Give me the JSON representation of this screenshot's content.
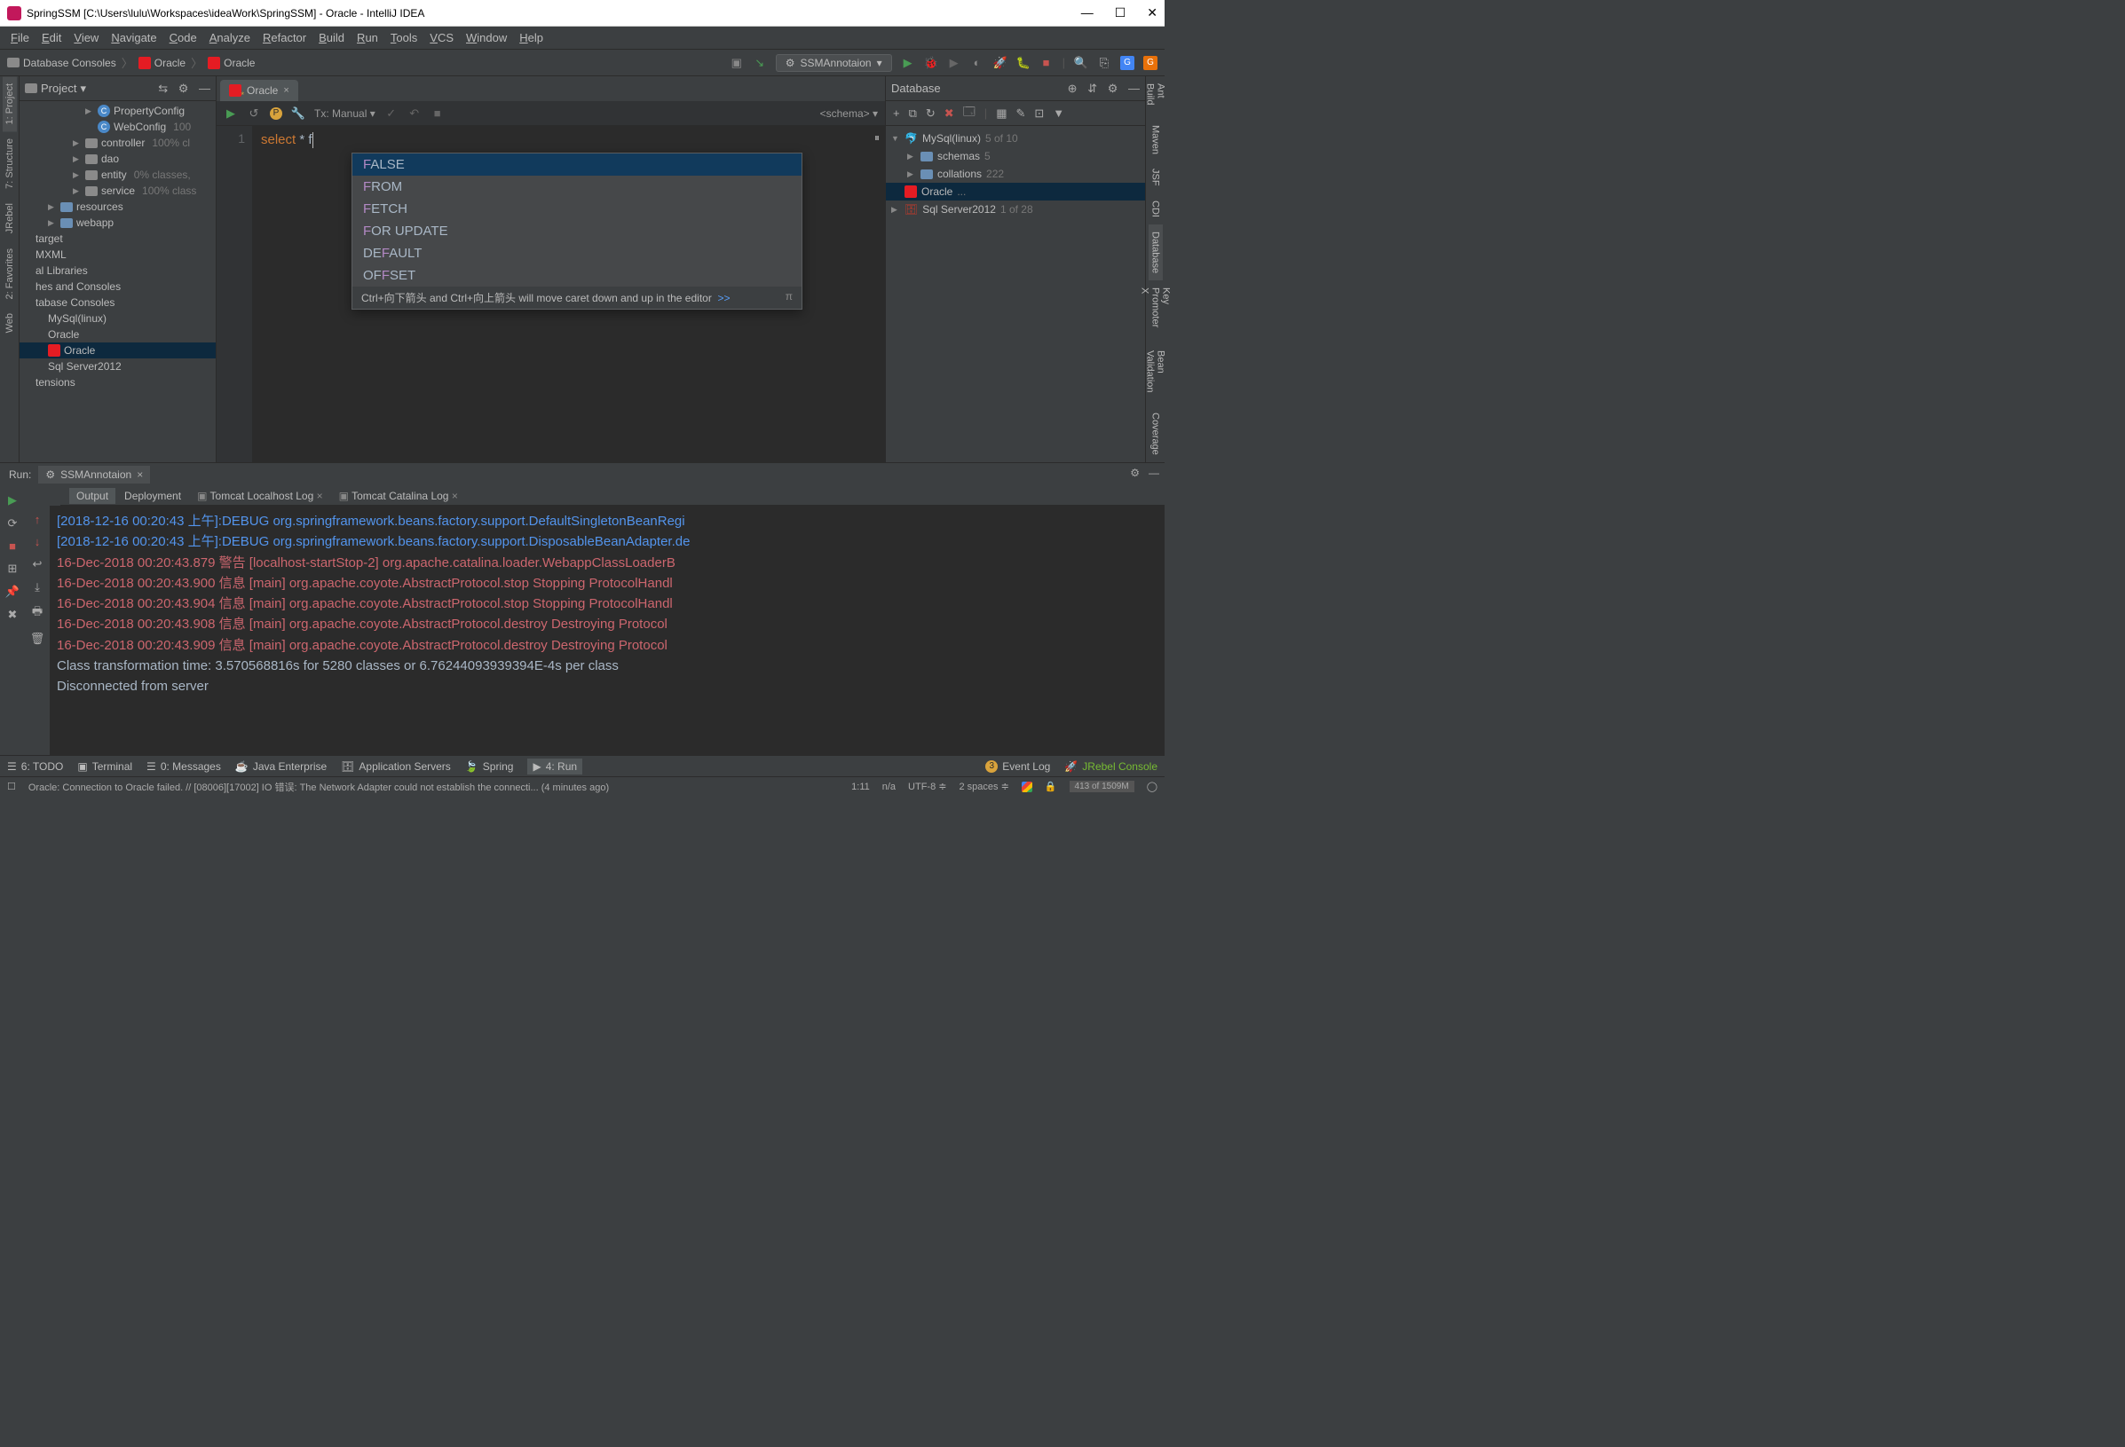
{
  "window": {
    "title": "SpringSSM [C:\\Users\\lulu\\Workspaces\\ideaWork\\SpringSSM] - Oracle - IntelliJ IDEA"
  },
  "menu": [
    "File",
    "Edit",
    "View",
    "Navigate",
    "Code",
    "Analyze",
    "Refactor",
    "Build",
    "Run",
    "Tools",
    "VCS",
    "Window",
    "Help"
  ],
  "breadcrumb": [
    "Database Consoles",
    "Oracle",
    "Oracle"
  ],
  "runConfig": "SSMAnnotaion",
  "projectPanel": {
    "title": "Project",
    "tree": [
      {
        "indent": 5,
        "arrow": "▶",
        "icon": "class",
        "label": "PropertyConfig",
        "hint": ""
      },
      {
        "indent": 5,
        "arrow": "",
        "icon": "class",
        "label": "WebConfig",
        "hint": "100"
      },
      {
        "indent": 4,
        "arrow": "▶",
        "icon": "folder",
        "label": "controller",
        "hint": "100% cl"
      },
      {
        "indent": 4,
        "arrow": "▶",
        "icon": "folder",
        "label": "dao",
        "hint": ""
      },
      {
        "indent": 4,
        "arrow": "▶",
        "icon": "folder",
        "label": "entity",
        "hint": "0% classes,"
      },
      {
        "indent": 4,
        "arrow": "▶",
        "icon": "folder",
        "label": "service",
        "hint": "100% class"
      },
      {
        "indent": 2,
        "arrow": "▶",
        "icon": "bfolder",
        "label": "resources",
        "hint": ""
      },
      {
        "indent": 2,
        "arrow": "▶",
        "icon": "bfolder",
        "label": "webapp",
        "hint": ""
      },
      {
        "indent": 0,
        "arrow": "",
        "icon": "",
        "label": "target",
        "hint": ""
      },
      {
        "indent": 0,
        "arrow": "",
        "icon": "",
        "label": "MXML",
        "hint": ""
      },
      {
        "indent": 0,
        "arrow": "",
        "icon": "",
        "label": "al Libraries",
        "hint": ""
      },
      {
        "indent": 0,
        "arrow": "",
        "icon": "",
        "label": "hes and Consoles",
        "hint": ""
      },
      {
        "indent": 0,
        "arrow": "",
        "icon": "",
        "label": "tabase Consoles",
        "hint": ""
      },
      {
        "indent": 1,
        "arrow": "",
        "icon": "",
        "label": "MySql(linux)",
        "hint": ""
      },
      {
        "indent": 1,
        "arrow": "",
        "icon": "",
        "label": "Oracle",
        "hint": ""
      },
      {
        "indent": 1,
        "arrow": "",
        "icon": "oracle",
        "label": "Oracle",
        "hint": "",
        "sel": true
      },
      {
        "indent": 1,
        "arrow": "",
        "icon": "",
        "label": "Sql Server2012",
        "hint": ""
      },
      {
        "indent": 0,
        "arrow": "",
        "icon": "",
        "label": "tensions",
        "hint": ""
      }
    ]
  },
  "editor": {
    "tabLabel": "Oracle",
    "txLabel": "Tx: Manual",
    "schemaLabel": "<schema>",
    "lineNo": "1",
    "code": {
      "kw": "select",
      "rest": " * f"
    },
    "completion": {
      "items": [
        {
          "pre": "",
          "hl": "F",
          "post": "ALSE",
          "sel": true
        },
        {
          "pre": "",
          "hl": "F",
          "post": "ROM"
        },
        {
          "pre": "",
          "hl": "F",
          "post": "ETCH"
        },
        {
          "pre": "",
          "hl": "F",
          "post": "OR UPDATE"
        },
        {
          "pre": "DE",
          "hl": "F",
          "post": "AULT"
        },
        {
          "pre": "OF",
          "hl": "F",
          "post": "SET"
        }
      ],
      "hint": "Ctrl+向下箭头 and Ctrl+向上箭头 will move caret down and up in the editor",
      "hintLink": ">>"
    }
  },
  "database": {
    "title": "Database",
    "tree": [
      {
        "indent": 0,
        "arrow": "▼",
        "icon": "mysql",
        "label": "MySql(linux)",
        "hint": "5 of 10"
      },
      {
        "indent": 1,
        "arrow": "▶",
        "icon": "bfolder",
        "label": "schemas",
        "hint": "5"
      },
      {
        "indent": 1,
        "arrow": "▶",
        "icon": "bfolder",
        "label": "collations",
        "hint": "222"
      },
      {
        "indent": 0,
        "arrow": "",
        "icon": "oracle",
        "label": "Oracle",
        "hint": "...",
        "sel": true
      },
      {
        "indent": 0,
        "arrow": "▶",
        "icon": "sqls",
        "label": "Sql Server2012",
        "hint": "1 of 28"
      }
    ]
  },
  "run": {
    "label": "Run:",
    "configTab": "SSMAnnotaion",
    "subTabs": [
      "Output",
      "Deployment",
      "Tomcat Localhost Log",
      "Tomcat Catalina Log"
    ],
    "lines": [
      {
        "cls": "cdate",
        "text": "[2018-12-16 00:20:43 上午]:DEBUG org.springframework.beans.factory.support.DefaultSingletonBeanRegi"
      },
      {
        "cls": "cdate",
        "text": "[2018-12-16 00:20:43 上午]:DEBUG org.springframework.beans.factory.support.DisposableBeanAdapter.de"
      },
      {
        "cls": "cred",
        "text": "16-Dec-2018 00:20:43.879 警告 [localhost-startStop-2] org.apache.catalina.loader.WebappClassLoaderB"
      },
      {
        "cls": "cred",
        "text": "16-Dec-2018 00:20:43.900 信息 [main] org.apache.coyote.AbstractProtocol.stop Stopping ProtocolHandl"
      },
      {
        "cls": "cred",
        "text": "16-Dec-2018 00:20:43.904 信息 [main] org.apache.coyote.AbstractProtocol.stop Stopping ProtocolHandl"
      },
      {
        "cls": "cred",
        "text": "16-Dec-2018 00:20:43.908 信息 [main] org.apache.coyote.AbstractProtocol.destroy Destroying Protocol"
      },
      {
        "cls": "cred",
        "text": "16-Dec-2018 00:20:43.909 信息 [main] org.apache.coyote.AbstractProtocol.destroy Destroying Protocol"
      },
      {
        "cls": "cwhite",
        "text": "Class transformation time: 3.570568816s for 5280 classes or 6.76244093939394E-4s per class"
      },
      {
        "cls": "cwhite",
        "text": "Disconnected from server"
      }
    ]
  },
  "bottomTabs": {
    "todo": "6: TODO",
    "terminal": "Terminal",
    "messages": "0: Messages",
    "javaEE": "Java Enterprise",
    "appServers": "Application Servers",
    "spring": "Spring",
    "run": "4: Run",
    "eventLog": "Event Log",
    "eventCount": "3",
    "jrebel": "JRebel Console"
  },
  "leftTabs": [
    "1: Project",
    "7: Structure",
    "JRebel",
    "2: Favorites",
    "Web"
  ],
  "rightTabs": [
    "Ant Build",
    "Maven",
    "JSF",
    "CDI",
    "Database",
    "Key Promoter X",
    "Bean Validation",
    "Coverage"
  ],
  "status": {
    "msg": "Oracle: Connection to Oracle failed. // [08006][17002] IO 错误: The Network Adapter could not establish the connecti... (4 minutes ago)",
    "pos": "1:11",
    "na": "n/a",
    "enc": "UTF-8",
    "indent": "2 spaces",
    "mem": "413 of 1509M"
  }
}
